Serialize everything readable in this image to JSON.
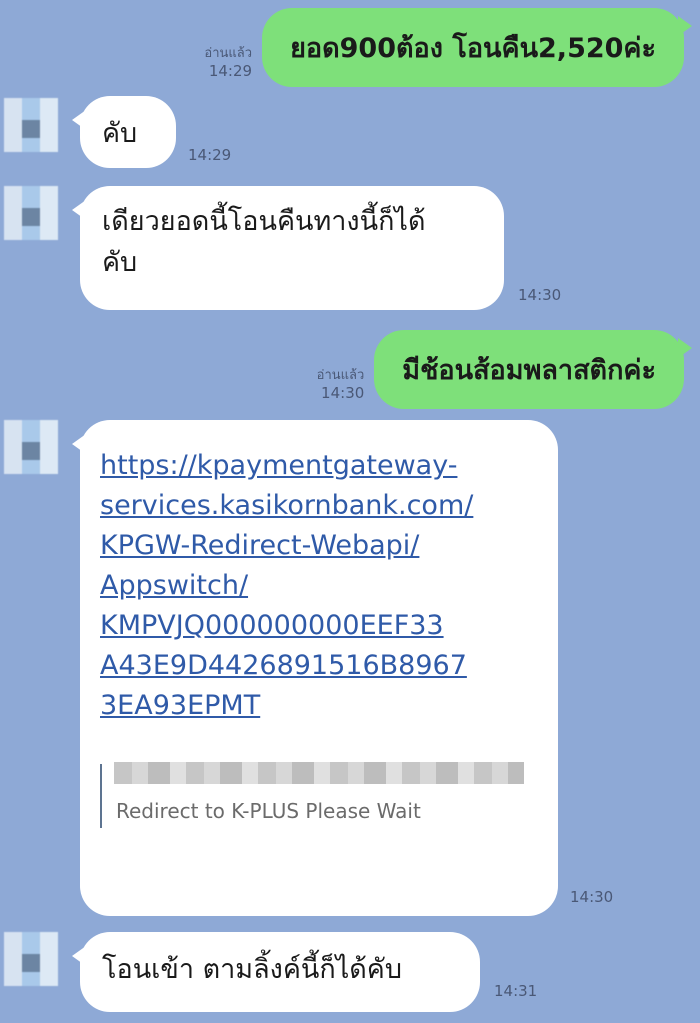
{
  "messages": [
    {
      "dir": "out",
      "read": "อ่านแล้ว",
      "time": "14:29",
      "text": "ยอด900ต้อง โอนคืน2,520ค่ะ"
    },
    {
      "dir": "in",
      "time": "14:29",
      "text": "คับ"
    },
    {
      "dir": "in",
      "time": "14:30",
      "lines": [
        "เดียวยอดนี้โอนคืนทางนี้ก็ได้",
        "คับ"
      ]
    },
    {
      "dir": "out",
      "read": "อ่านแล้ว",
      "time": "14:30",
      "text": "มีช้อนส้อมพลาสติกค่ะ"
    },
    {
      "dir": "in",
      "time": "14:30",
      "link_lines": [
        "https://kpaymentgateway-",
        "services.kasikornbank.com/",
        "KPGW-Redirect-Webapi/",
        "Appswitch/",
        "KMPVJQ000000000EEF33",
        "A43E9D4426891516B8967",
        "3EA93EPMT"
      ],
      "preview_text": "Redirect to K-PLUS Please Wait"
    },
    {
      "dir": "in",
      "time": "14:31",
      "text": "โอนเข้า ตามลิ้งค์นี้ก็ได้คับ"
    }
  ],
  "colors": {
    "background": "#8ea9d6",
    "bubble_out": "#7ee07a",
    "bubble_in": "#ffffff",
    "link": "#2f5aa8"
  }
}
